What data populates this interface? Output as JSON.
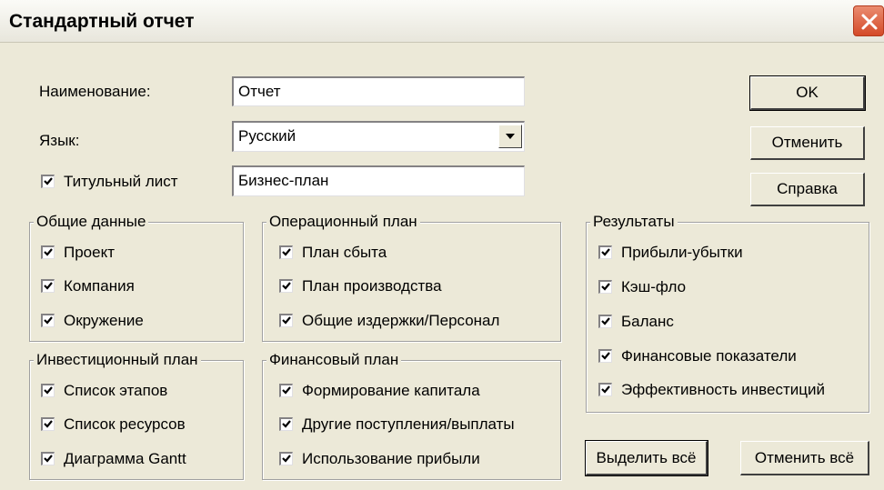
{
  "window": {
    "title": "Стандартный отчет"
  },
  "form": {
    "name_label": "Наименование:",
    "name_value": "Отчет",
    "lang_label": "Язык:",
    "lang_value": "Русский",
    "title_page_label": "Титульный лист",
    "title_page_checked": true,
    "title_page_value": "Бизнес-план"
  },
  "buttons": {
    "ok": "OK",
    "cancel": "Отменить",
    "help": "Справка",
    "select_all": "Выделить всё",
    "deselect_all": "Отменить всё"
  },
  "groups": {
    "general": {
      "title": "Общие данные",
      "items": [
        {
          "label": "Проект",
          "checked": true
        },
        {
          "label": "Компания",
          "checked": true
        },
        {
          "label": "Окружение",
          "checked": true
        }
      ]
    },
    "investment": {
      "title": "Инвестиционный план",
      "items": [
        {
          "label": "Список этапов",
          "checked": true
        },
        {
          "label": "Список ресурсов",
          "checked": true
        },
        {
          "label": "Диаграмма Gantt",
          "checked": true
        }
      ]
    },
    "operational": {
      "title": "Операционный план",
      "items": [
        {
          "label": "План сбыта",
          "checked": true
        },
        {
          "label": "План производства",
          "checked": true
        },
        {
          "label": "Общие издержки/Персонал",
          "checked": true
        }
      ]
    },
    "financial": {
      "title": "Финансовый план",
      "items": [
        {
          "label": "Формирование капитала",
          "checked": true
        },
        {
          "label": "Другие поступления/выплаты",
          "checked": true
        },
        {
          "label": "Использование прибыли",
          "checked": true
        }
      ]
    },
    "results": {
      "title": "Результаты",
      "items": [
        {
          "label": "Прибыли-убытки",
          "checked": true
        },
        {
          "label": "Кэш-фло",
          "checked": true
        },
        {
          "label": "Баланс",
          "checked": true
        },
        {
          "label": "Финансовые показатели",
          "checked": true
        },
        {
          "label": "Эффективность инвестиций",
          "checked": true
        }
      ]
    }
  },
  "icons": {
    "close": "close-icon",
    "dropdown": "chevron-down-icon",
    "check": "checkmark-icon"
  },
  "colors": {
    "face": "#ece9d8",
    "close_button": "#d44a28"
  }
}
